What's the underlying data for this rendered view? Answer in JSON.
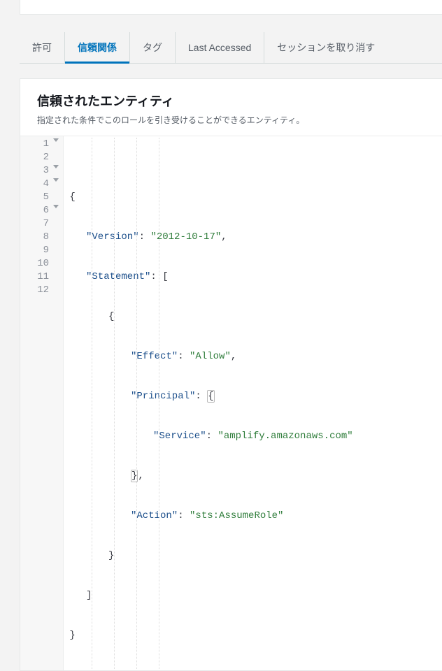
{
  "tabs": {
    "permissions": "許可",
    "trust": "信頼関係",
    "tags": "タグ",
    "last_accessed": "Last Accessed",
    "revoke": "セッションを取り消す"
  },
  "panel": {
    "title": "信頼されたエンティティ",
    "description": "指定された条件でこのロールを引き受けることができるエンティティ。"
  },
  "policy": {
    "version_key": "\"Version\"",
    "version_val": "\"2012-10-17\"",
    "statement_key": "\"Statement\"",
    "effect_key": "\"Effect\"",
    "effect_val": "\"Allow\"",
    "principal_key": "\"Principal\"",
    "service_key": "\"Service\"",
    "service_val": "\"amplify.amazonaws.com\"",
    "action_key": "\"Action\"",
    "action_val": "\"sts:AssumeRole\""
  },
  "lines": [
    "1",
    "2",
    "3",
    "4",
    "5",
    "6",
    "7",
    "8",
    "9",
    "10",
    "11",
    "12"
  ]
}
